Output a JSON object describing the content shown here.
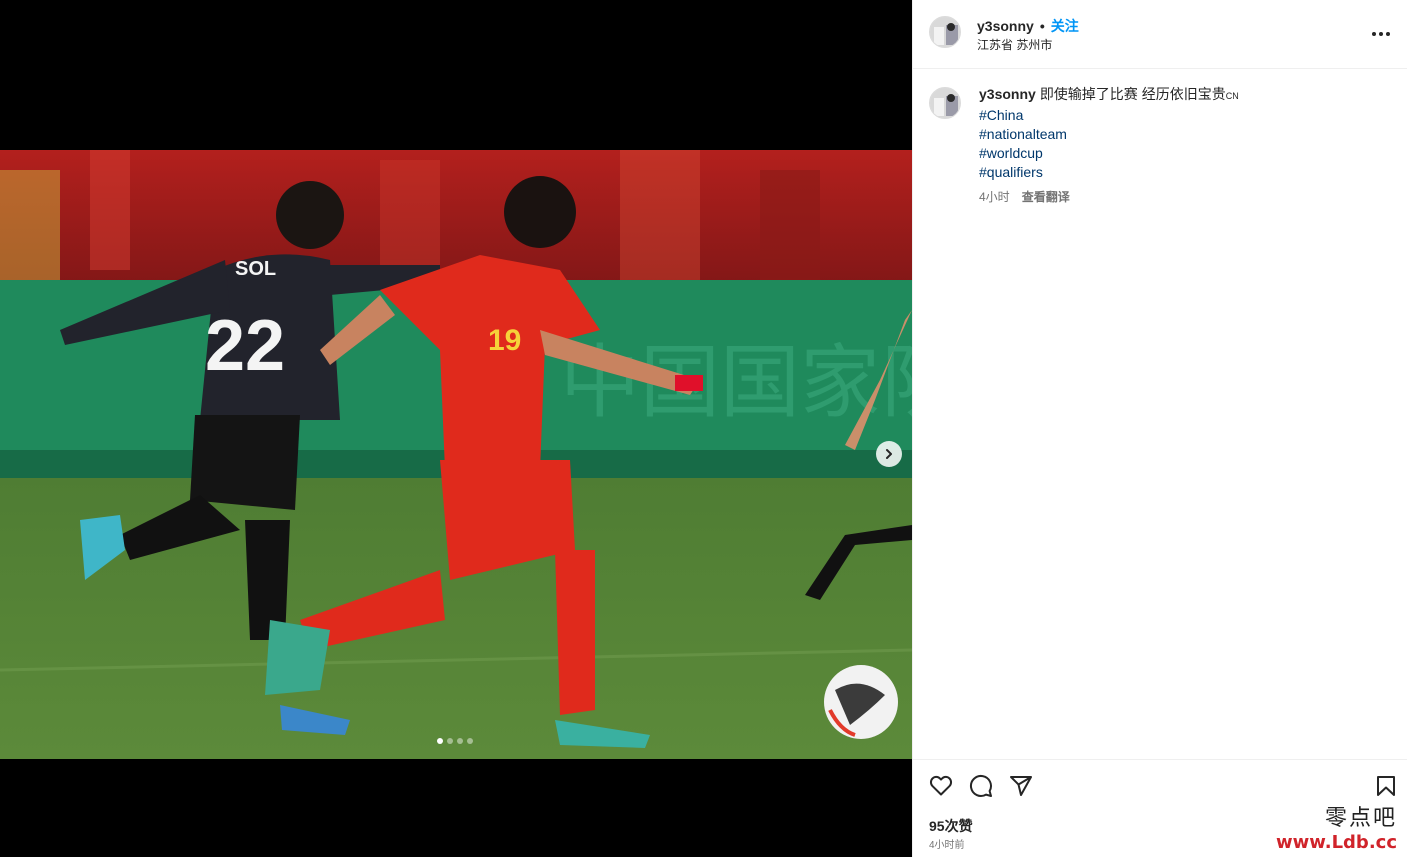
{
  "header": {
    "username": "y3sonny",
    "separator": "•",
    "follow_label": "关注",
    "location": "江苏省 苏州市"
  },
  "caption": {
    "username": "y3sonny",
    "text": "即使输掉了比赛 经历依旧宝贵",
    "suffix": "CN",
    "hashtags": [
      "#China",
      "#nationalteam",
      "#worldcup",
      "#qualifiers"
    ],
    "age": "4小时",
    "translate_label": "查看翻译"
  },
  "post": {
    "likes": "95次赞",
    "time_ago": "4小时前",
    "carousel_count": 4,
    "carousel_active": 0
  },
  "photo": {
    "jersey_back_text": "SOL",
    "jersey_back_number": "22",
    "jersey_front_number": "19"
  },
  "icons": [
    "more-icon",
    "heart-icon",
    "comment-icon",
    "share-icon",
    "bookmark-icon",
    "chevron-right-icon"
  ],
  "watermark": {
    "chinese": "零点吧",
    "url": "www.Ldb.cc"
  },
  "colors": {
    "follow": "#0095f6",
    "hashtag": "#00376b",
    "watermark_url": "#d0232a"
  }
}
